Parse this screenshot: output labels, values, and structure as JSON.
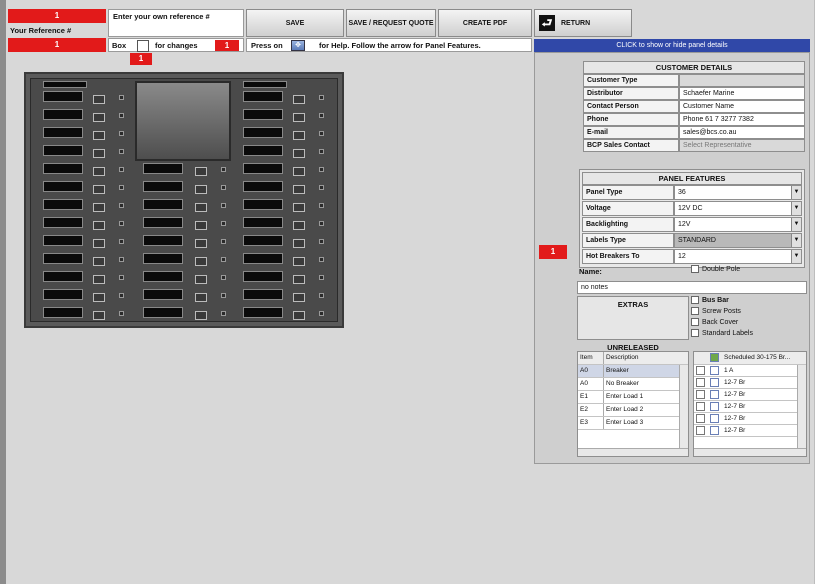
{
  "top": {
    "red1": "1",
    "ref_label": "Your Reference #",
    "red2": "1",
    "enter_ref_text": "Enter your own reference #",
    "box_label": "Box",
    "changes_label": "for changes",
    "red3": "1",
    "red4": "1",
    "press_text": "Press on",
    "help_text": "for Help. Follow the arrow for Panel Features.",
    "buttons": [
      "SAVE",
      "SAVE / REQUEST QUOTE",
      "CREATE PDF",
      "RETURN"
    ]
  },
  "right": {
    "banner": "CLICK to show or hide panel details",
    "customer_header": "CUSTOMER DETAILS",
    "customer_rows": [
      {
        "label": "Customer Type",
        "value": ""
      },
      {
        "label": "Distributor",
        "value": "Schaefer Marine"
      },
      {
        "label": "Contact Person",
        "value": "Customer Name"
      },
      {
        "label": "Phone",
        "value": "Phone 61 7 3277 7382"
      },
      {
        "label": "E-mail",
        "value": "sales@bcs.co.au"
      },
      {
        "label": "BCP Sales Contact",
        "value": "Select Representative"
      }
    ],
    "panel_header": "PANEL FEATURES",
    "panel_rows": [
      {
        "label": "Panel Type",
        "value": "36"
      },
      {
        "label": "Voltage",
        "value": "12V DC"
      },
      {
        "label": "Backlighting",
        "value": "12V"
      },
      {
        "label": "Labels Type",
        "value": "STANDARD"
      },
      {
        "label": "Hot Breakers To",
        "value": "12"
      }
    ],
    "red_marker": "1",
    "name_label": "Name:",
    "double_pole": "Double Pole",
    "name_value": "no notes",
    "extras_label": "EXTRAS",
    "extras": [
      "Bus Bar",
      "Screw Posts",
      "Back Cover",
      "Standard Labels"
    ],
    "unreleased_label": "UNRELEASED",
    "left_list": {
      "columns": [
        "Item",
        "Description"
      ],
      "rows": [
        [
          "A0",
          "Breaker"
        ],
        [
          "A0",
          "No Breaker"
        ],
        [
          "E1",
          "Enter   Load 1"
        ],
        [
          "E2",
          "Enter   Load 2"
        ],
        [
          "E3",
          "Enter   Load 3"
        ]
      ]
    },
    "right_list": {
      "header": "Scheduled 30-175 Br...",
      "rows": [
        "1 A",
        "12-7 Br",
        "12-7 Br",
        "12-7 Br",
        "12-7 Br",
        "12-7 Br"
      ]
    }
  }
}
